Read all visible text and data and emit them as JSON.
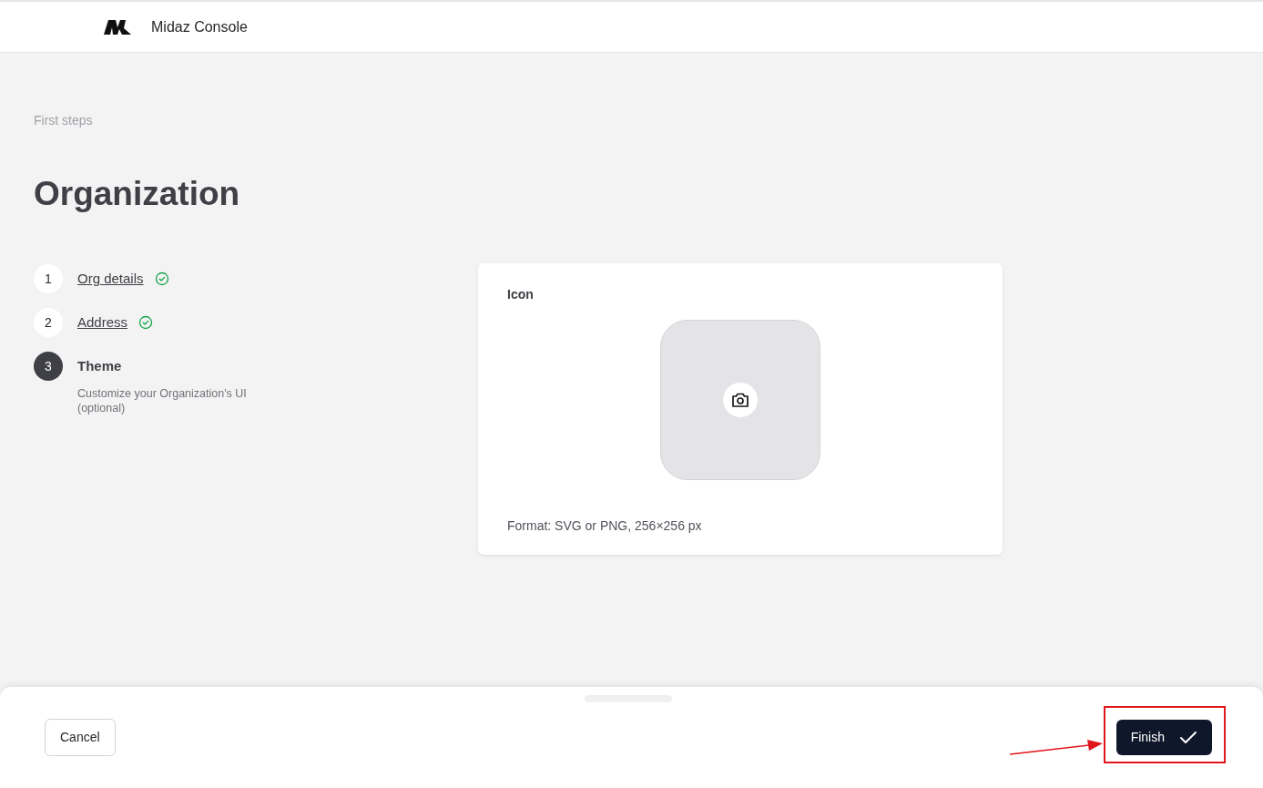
{
  "header": {
    "title": "Midaz Console"
  },
  "breadcrumb": "First steps",
  "page_title": "Organization",
  "steps": [
    {
      "number": "1",
      "label": "Org details",
      "completed": true,
      "selected": false
    },
    {
      "number": "2",
      "label": "Address",
      "completed": true,
      "selected": false
    },
    {
      "number": "3",
      "label": "Theme",
      "completed": false,
      "selected": true,
      "description": "Customize your Organization's UI (optional)"
    }
  ],
  "icon_card": {
    "label": "Icon",
    "hint": "Format: SVG or PNG, 256×256 px"
  },
  "footer": {
    "cancel": "Cancel",
    "finish": "Finish",
    "highlighted": true
  }
}
